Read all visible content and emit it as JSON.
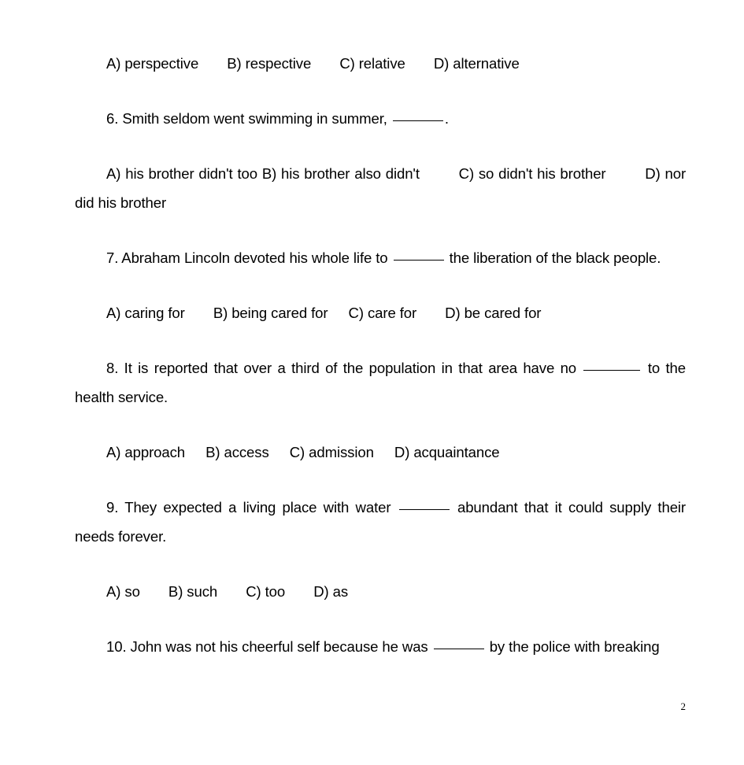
{
  "document": {
    "page_number": "2",
    "background_color": "#ffffff",
    "text_color": "#000000"
  },
  "content": {
    "q5_options": {
      "a": "A) perspective",
      "b": "B) respective",
      "c": "C) relative",
      "d": "D) alternative"
    },
    "q6": {
      "stem_before": "6. Smith seldom went swimming in summer,",
      "stem_after": ".",
      "options": {
        "a": "A) his brother didn't too",
        "b": "B) his brother also didn't",
        "c": "C) so didn't his brother",
        "d": "D) nor did his brother"
      }
    },
    "q7": {
      "stem_before": "7. Abraham Lincoln devoted his whole life to",
      "stem_after": "the liberation of the black people.",
      "options": {
        "a": "A) caring for",
        "b": "B) being cared for",
        "c": "C) care for",
        "d": "D) be cared for"
      }
    },
    "q8": {
      "stem_before": "8. It is reported that over a third of the population in that area have no",
      "stem_after": "to the health service.",
      "options": {
        "a": "A) approach",
        "b": "B) access",
        "c": "C) admission",
        "d": "D) acquaintance"
      }
    },
    "q9": {
      "stem_before": "9. They expected a living place with water",
      "stem_after": "abundant that it could supply their needs forever.",
      "options": {
        "a": "A) so",
        "b": "B) such",
        "c": "C) too",
        "d": "D) as"
      }
    },
    "q10": {
      "stem_before": "10. John was not his cheerful self because he was",
      "stem_after": "by the police with breaking"
    }
  }
}
